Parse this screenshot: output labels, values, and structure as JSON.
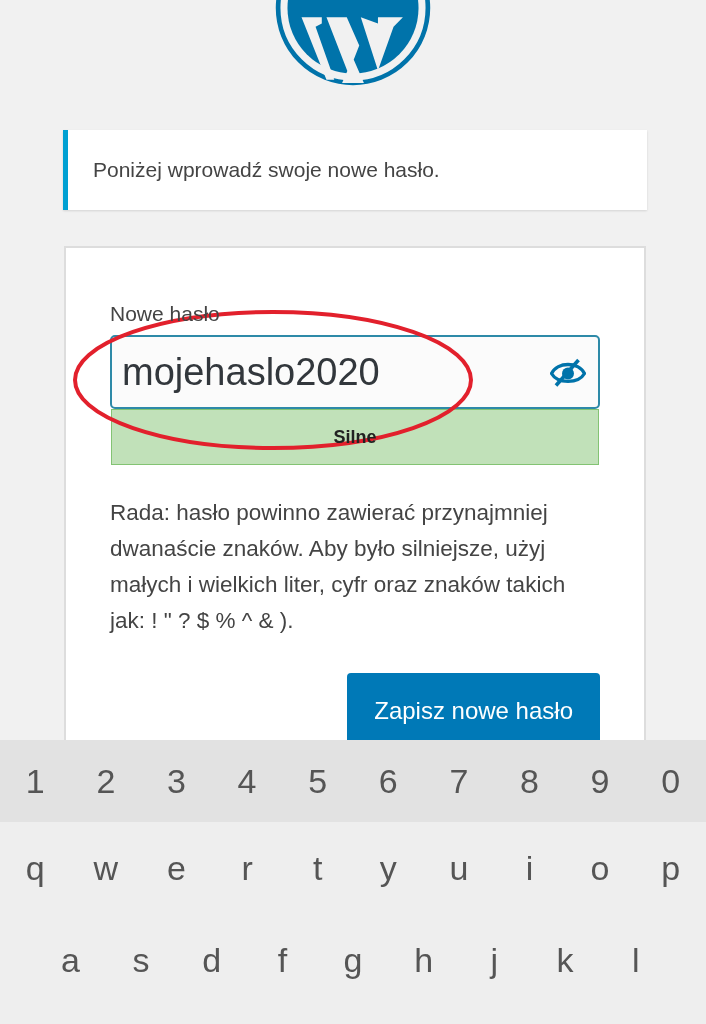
{
  "notice": {
    "text": "Poniżej wprowadź swoje nowe hasło."
  },
  "form": {
    "label": "Nowe hasło",
    "password": "mojehaslo2020",
    "password_visible": true,
    "focused": true,
    "strength": {
      "text": "Silne",
      "kind": "strong"
    },
    "hint": "Rada: hasło powinno zawierać przynajmniej dwanaście znaków. Aby było silniejsze, użyj małych i wielkich liter, cyfr oraz znaków takich jak: ! \" ? $ % ^ & ).",
    "submit": "Zapisz nowe hasło"
  },
  "annotation": {
    "kind": "ellipse"
  },
  "keyboard": {
    "rows": [
      {
        "kind": "numbers",
        "keys": [
          "1",
          "2",
          "3",
          "4",
          "5",
          "6",
          "7",
          "8",
          "9",
          "0"
        ]
      },
      {
        "kind": "letters",
        "keys": [
          "q",
          "w",
          "e",
          "r",
          "t",
          "y",
          "u",
          "i",
          "o",
          "p"
        ]
      },
      {
        "kind": "letters",
        "keys": [
          "a",
          "s",
          "d",
          "f",
          "g",
          "h",
          "j",
          "k",
          "l"
        ]
      }
    ]
  }
}
